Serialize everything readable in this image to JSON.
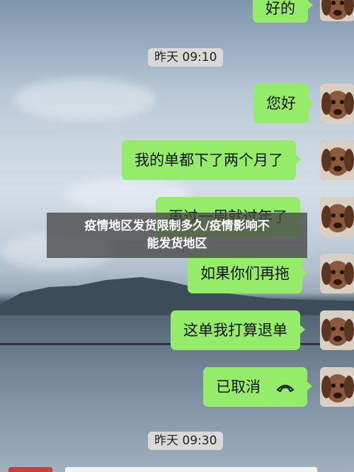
{
  "chat": {
    "timestamps": [
      "昨天 09:10",
      "昨天 09:30"
    ],
    "messages": [
      {
        "text": "好的"
      },
      {
        "text": "您好"
      },
      {
        "text": "我的单都下了两个月了"
      },
      {
        "text": "再过一周就过年了"
      },
      {
        "text": "如果你们再拖"
      },
      {
        "text": "这单我打算退单"
      },
      {
        "text": "已取消",
        "icon": "phone-hangup-icon"
      }
    ]
  },
  "overlay": {
    "line1": "疫情地区发货限制多久/疫情影响不",
    "line2": "能发货地区"
  },
  "colors": {
    "bubble": "#95ec69",
    "time_pill": "#d9d9d9",
    "overlay": "rgba(70,70,70,0.78)"
  }
}
